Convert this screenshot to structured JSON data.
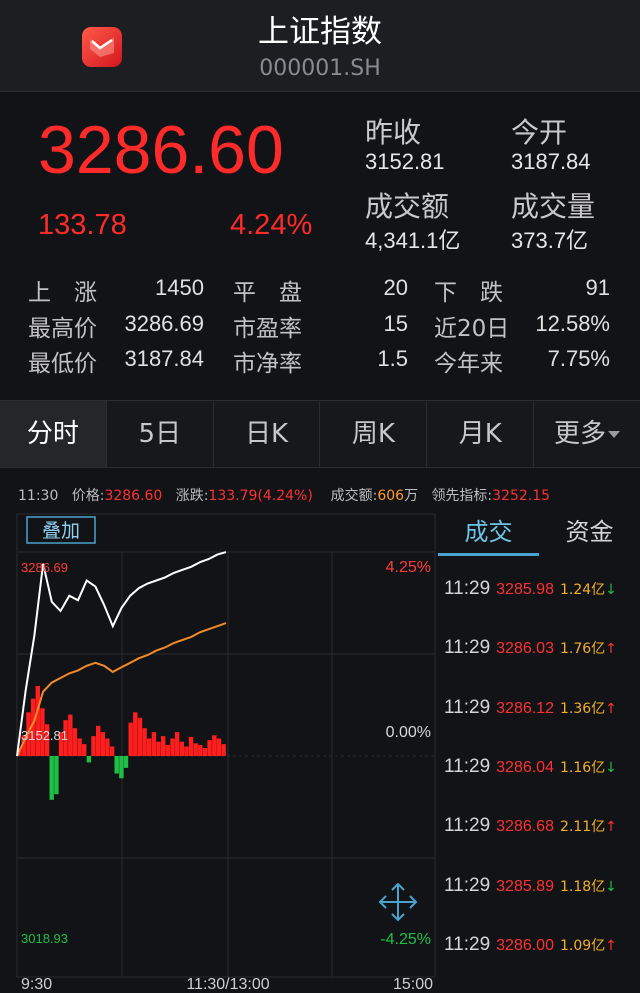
{
  "header": {
    "title": "上证指数",
    "code": "000001.SH"
  },
  "quote": {
    "price": "3286.60",
    "change": "133.78",
    "change_pct": "4.24%",
    "prev_close_label": "昨收",
    "prev_close": "3152.81",
    "open_label": "今开",
    "open": "3187.84",
    "turnover_label": "成交额",
    "turnover": "4,341.1亿",
    "volume_label": "成交量",
    "volume": "373.7亿"
  },
  "market": {
    "up_label": "上　涨",
    "up": "1450",
    "flat_label": "平　盘",
    "flat": "20",
    "down_label": "下　跌",
    "down": "91",
    "high_label": "最高价",
    "high": "3286.69",
    "pe_label": "市盈率",
    "pe": "15",
    "d20_label": "近20日",
    "d20": "12.58%",
    "low_label": "最低价",
    "low": "3187.84",
    "pb_label": "市净率",
    "pb": "1.5",
    "ytd_label": "今年来",
    "ytd": "7.75%"
  },
  "tabs": [
    "分时",
    "5日",
    "日K",
    "周K",
    "月K",
    "更多"
  ],
  "infoline": {
    "time": "11:30",
    "price_label": "价格:",
    "price": "3286.60",
    "change_label": "涨跌:",
    "change": "133.79(4.24%)",
    "amount_label": "成交额:",
    "amount": "606",
    "amount_unit": "万",
    "lead_label": "领先指标:",
    "lead": "3252.15"
  },
  "chart": {
    "overlay_button": "叠加",
    "y_top_price": "3286.69",
    "y_mid_price": "3152.81",
    "y_bottom_price": "3018.93",
    "y_top_pct": "4.25%",
    "y_mid_pct": "0.00%",
    "y_bottom_pct": "-4.25%",
    "x_labels": [
      "9:30",
      "11:30/13:00",
      "15:00"
    ],
    "colors": {
      "price_line": "#ffffff",
      "avg_line": "#f08a2a",
      "up": "#ff1e1e",
      "down": "#1fbf46"
    }
  },
  "chart_data": {
    "type": "line",
    "series": [
      {
        "values": [
          3152.81,
          3196,
          3232,
          3279,
          3254,
          3248,
          3258,
          3255,
          3268,
          3264,
          3252,
          3238,
          3250,
          3258,
          3263,
          3266,
          3268,
          3270,
          3273,
          3275,
          3277,
          3280,
          3282,
          3285,
          3286.6
        ]
      },
      {
        "values": [
          3152.81,
          3165,
          3176,
          3195,
          3201,
          3204,
          3207,
          3209,
          3212,
          3214,
          3212,
          3208,
          3211,
          3214,
          3217,
          3219,
          3222,
          3224,
          3227,
          3229,
          3231,
          3234,
          3236,
          3238,
          3240
        ]
      }
    ],
    "volume_net": [
      10,
      26,
      55,
      72,
      88,
      60,
      40,
      -55,
      -48,
      30,
      45,
      52,
      35,
      22,
      15,
      -8,
      25,
      38,
      30,
      22,
      12,
      -22,
      -28,
      -15,
      42,
      55,
      48,
      35,
      22,
      30,
      18,
      25,
      14,
      22,
      30,
      18,
      12,
      24,
      16,
      14,
      10,
      20,
      26,
      22,
      15
    ],
    "ylim": [
      3018.93,
      3286.69
    ],
    "session_split_index": 24
  },
  "side": {
    "tabs": [
      "成交",
      "资金"
    ],
    "trades": [
      {
        "time": "11:29",
        "price": "3285.98",
        "vol": "1.24亿",
        "dir": "down"
      },
      {
        "time": "11:29",
        "price": "3286.03",
        "vol": "1.76亿",
        "dir": "up"
      },
      {
        "time": "11:29",
        "price": "3286.12",
        "vol": "1.36亿",
        "dir": "up"
      },
      {
        "time": "11:29",
        "price": "3286.04",
        "vol": "1.16亿",
        "dir": "down"
      },
      {
        "time": "11:29",
        "price": "3286.68",
        "vol": "2.11亿",
        "dir": "up"
      },
      {
        "time": "11:29",
        "price": "3285.89",
        "vol": "1.18亿",
        "dir": "down"
      },
      {
        "time": "11:29",
        "price": "3286.00",
        "vol": "1.09亿",
        "dir": "up"
      }
    ]
  }
}
